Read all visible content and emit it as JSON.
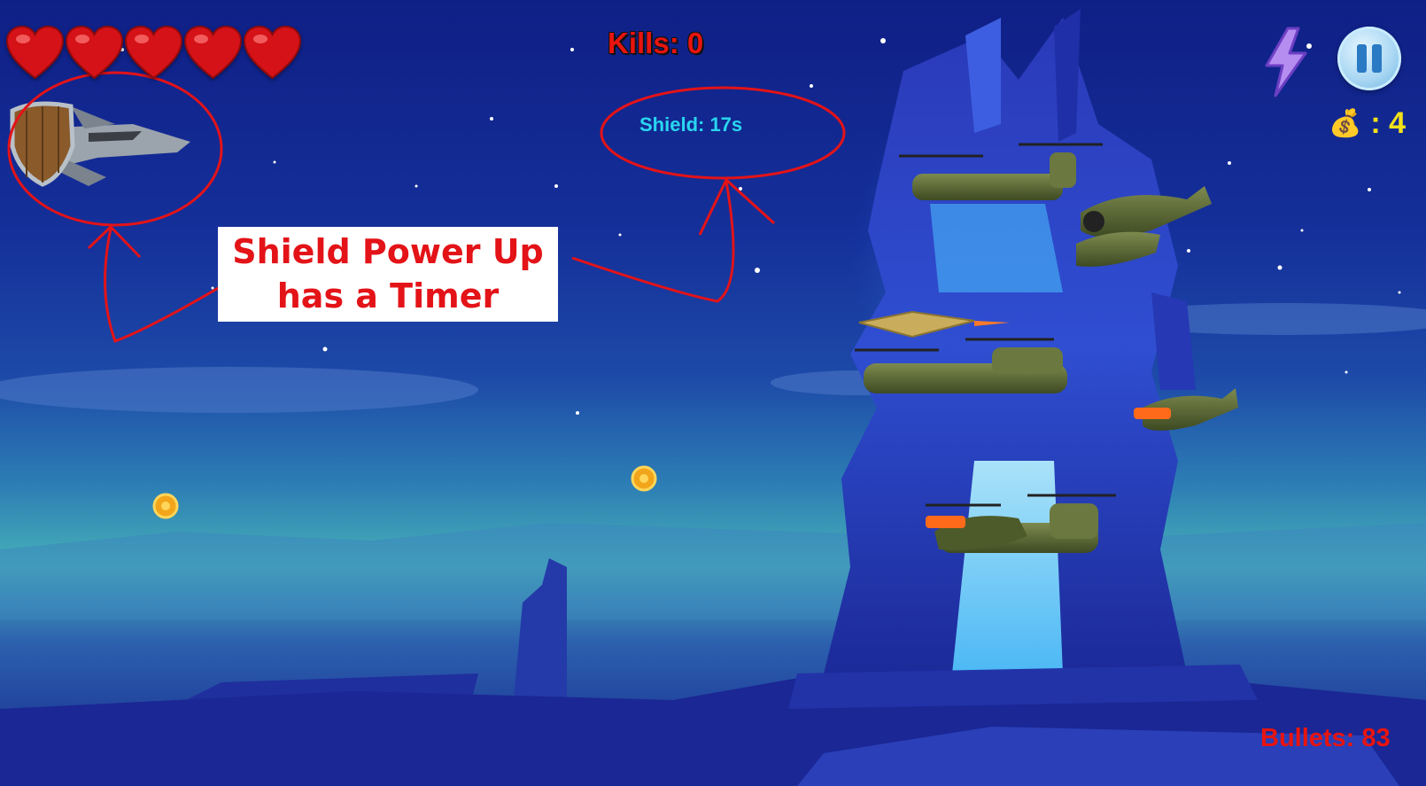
{
  "hud": {
    "kills_label": "Kills: 0",
    "shield_timer_label": "Shield: 17s",
    "bullets_label": "Bullets: 83",
    "coins_count": ": 4",
    "lives": 5
  },
  "annotation": {
    "line1": "Shield Power Up",
    "line2": "has a Timer"
  },
  "icons": {
    "life": "heart-icon",
    "coin_bag": "money-bag-icon",
    "power": "lightning-icon",
    "pause": "pause-icon"
  },
  "colors": {
    "kills_text": "#e8140f",
    "shield_text": "#29d6f0",
    "coins_text": "#f2e21a",
    "annotation": "#e31318"
  }
}
